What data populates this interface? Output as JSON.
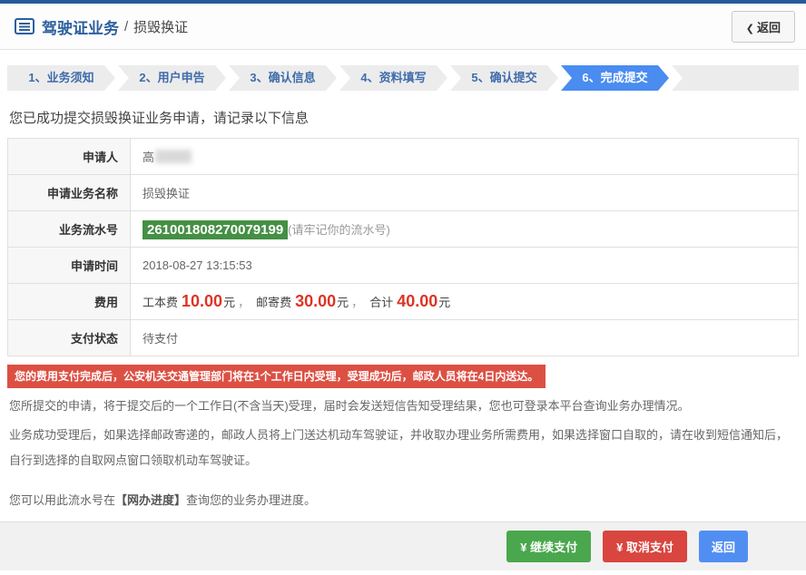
{
  "header": {
    "title": "驾驶证业务",
    "separator": "/",
    "subtitle": "损毁换证",
    "back": {
      "icon": "❮",
      "label": "返回"
    }
  },
  "steps": [
    {
      "label": "1、业务须知",
      "active": false
    },
    {
      "label": "2、用户申告",
      "active": false
    },
    {
      "label": "3、确认信息",
      "active": false
    },
    {
      "label": "4、资料填写",
      "active": false
    },
    {
      "label": "5、确认提交",
      "active": false
    },
    {
      "label": "6、完成提交",
      "active": true
    }
  ],
  "success_message": "您已成功提交损毁换证业务申请，请记录以下信息",
  "details": {
    "applicant": {
      "label": "申请人",
      "value": "高"
    },
    "business_name": {
      "label": "申请业务名称",
      "value": "损毁换证"
    },
    "serial": {
      "label": "业务流水号",
      "number": "261001808270079199",
      "note": "(请牢记你的流水号)"
    },
    "apply_time": {
      "label": "申请时间",
      "value": "2018-08-27 13:15:53"
    },
    "fee": {
      "label": "费用",
      "item1_label": "工本费",
      "item1_value": "10.00",
      "item1_unit": "元",
      "sep1": "，",
      "item2_label": "邮寄费",
      "item2_value": "30.00",
      "item2_unit": "元",
      "sep2": "，",
      "total_label": "合计",
      "total_value": "40.00",
      "total_unit": "元"
    },
    "payment_status": {
      "label": "支付状态",
      "value": "待支付"
    }
  },
  "warning": "您的费用支付完成后，公安机关交通管理部门将在1个工作日内受理，受理成功后，邮政人员将在4日内送达。",
  "paragraphs": [
    "您所提交的申请，将于提交后的一个工作日(不含当天)受理，届时会发送短信告知受理结果，您也可登录本平台查询业务办理情况。",
    "业务成功受理后，如果选择邮政寄递的，邮政人员将上门送达机动车驾驶证，并收取办理业务所需费用，如果选择窗口自取的，请在收到短信通知后，自行到选择的自取网点窗口领取机动车驾驶证。"
  ],
  "progress_note": {
    "prefix": "您可以用此流水号在",
    "link": "【网办进度】",
    "suffix": "查询您的业务办理进度。"
  },
  "footer": {
    "buttons": [
      {
        "name": "continue-payment",
        "label": "¥ 继续支付"
      },
      {
        "name": "cancel-payment",
        "label": "¥ 取消支付"
      },
      {
        "name": "return",
        "label": "返回"
      }
    ]
  },
  "colors": {
    "accent_blue": "#2a5a9c",
    "active_step_blue": "#4a8cf0",
    "badge_green": "#449044",
    "warning_red": "#dc5044",
    "fee_red": "#dd3424",
    "button_green": "#4aa74d",
    "button_red": "#d9453f",
    "button_blue": "#518ef2"
  }
}
